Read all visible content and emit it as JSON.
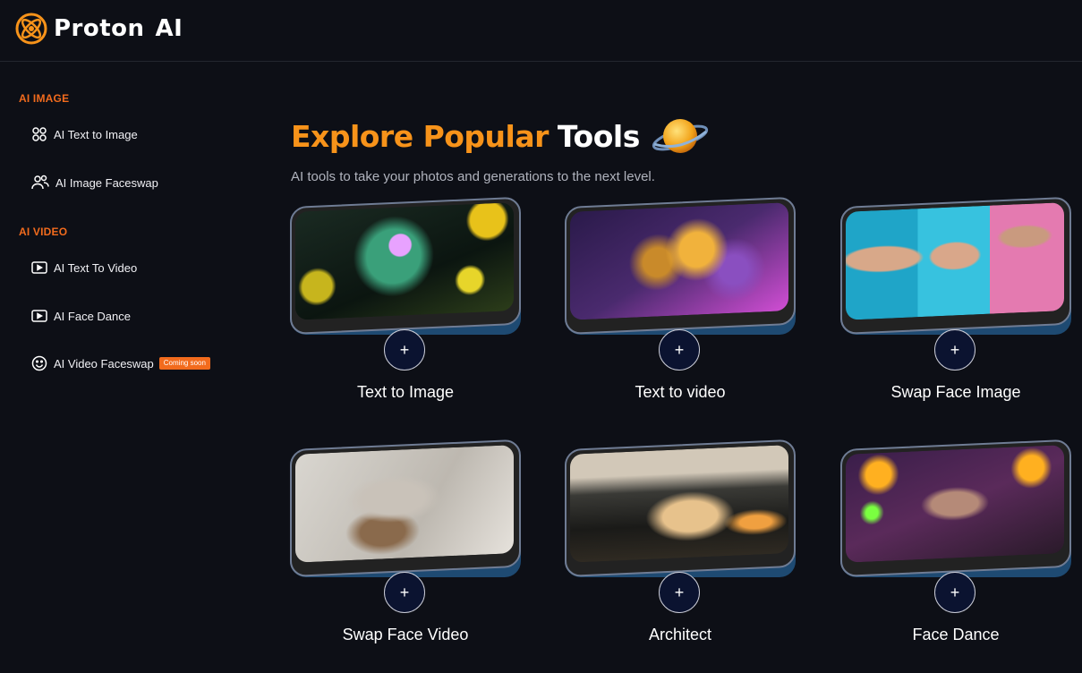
{
  "brand": {
    "name_part1": "Proton",
    "name_part2": "AI"
  },
  "sidebar": {
    "sections": [
      {
        "title": "AI IMAGE",
        "items": [
          {
            "label": "AI Text to Image",
            "icon": "grid-icon"
          },
          {
            "label": "AI Image Faceswap",
            "icon": "users-icon"
          }
        ]
      },
      {
        "title": "AI VIDEO",
        "items": [
          {
            "label": "AI Text To Video",
            "icon": "video-play-icon"
          },
          {
            "label": "AI Face Dance",
            "icon": "video-play-icon"
          },
          {
            "label": "AI Video Faceswap",
            "icon": "smiley-icon",
            "badge": "Coming soon"
          }
        ]
      }
    ]
  },
  "main": {
    "heading_highlight": "Explore Popular",
    "heading_rest": "Tools",
    "subheading": "AI tools to take your photos and generations to the next level.",
    "plus_symbol": "+",
    "tools": [
      {
        "label": "Text to Image",
        "art": "neon-monster"
      },
      {
        "label": "Text to video",
        "art": "golden-sculpture"
      },
      {
        "label": "Swap Face Image",
        "art": "three-faces"
      },
      {
        "label": "Swap Face Video",
        "art": "shattered-bust"
      },
      {
        "label": "Architect",
        "art": "futuristic-building"
      },
      {
        "label": "Face Dance",
        "art": "cyber-woman"
      }
    ]
  },
  "colors": {
    "accent": "#f26b1d",
    "heading_orange": "#f7931a",
    "background": "#0d0f16",
    "card_back": "#1e4a72"
  }
}
